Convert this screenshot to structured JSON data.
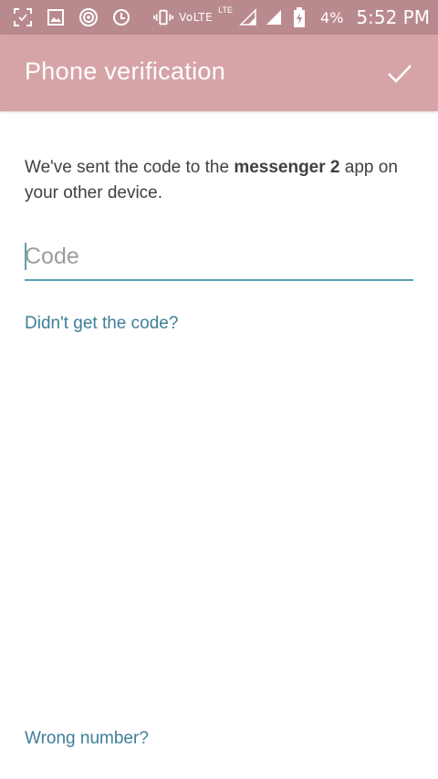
{
  "status_bar": {
    "volte": "VoLTE",
    "lte": "LTE",
    "battery_percent": "4%",
    "time": "5:52 PM",
    "icons": [
      "screenshot-icon",
      "image-icon",
      "hotspot-icon",
      "sync-icon",
      "vibrate-icon",
      "signal-icon",
      "signal-full-icon",
      "battery-charging-icon"
    ]
  },
  "app_bar": {
    "title": "Phone verification",
    "confirm_icon": "check-icon",
    "background": "#d6a4a6"
  },
  "content": {
    "message_prefix": "We've sent the code to the ",
    "message_app": "messenger 2",
    "message_suffix": " app on your other device.",
    "code_placeholder": "Code",
    "code_value": "",
    "resend_link": "Didn't get the code?",
    "wrong_number_link": "Wrong number?"
  },
  "colors": {
    "status_bar": "#b98a8d",
    "accent": "#5aa0b3",
    "link": "#3f7e99"
  }
}
